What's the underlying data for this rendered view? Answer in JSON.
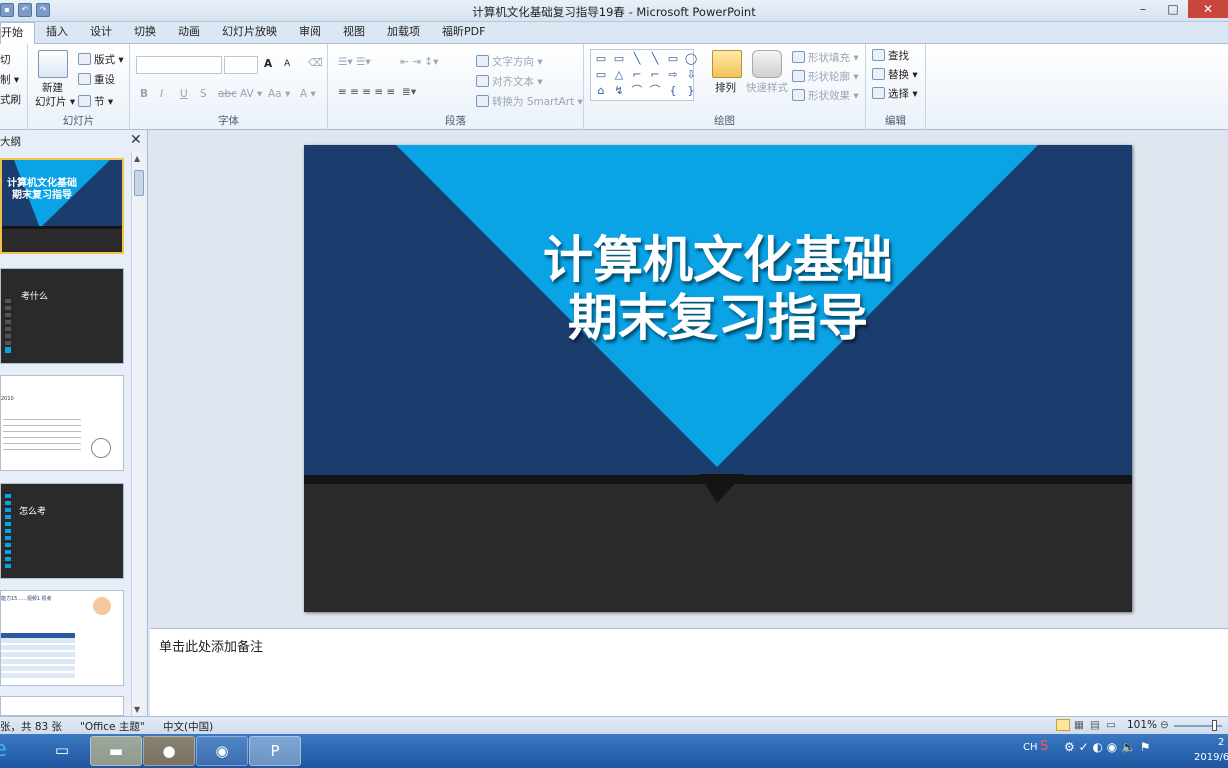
{
  "window": {
    "title": "计算机文化基础复习指导19春  -  Microsoft PowerPoint",
    "buttons": {
      "minimize": "–",
      "maximize": "□",
      "close": "✕"
    }
  },
  "tabs": [
    "开始",
    "插入",
    "设计",
    "切换",
    "动画",
    "幻灯片放映",
    "审阅",
    "视图",
    "加载项",
    "福昕PDF"
  ],
  "ribbon": {
    "clipboard": {
      "cut": "切",
      "copy": "制 ▾",
      "painter": "式刷",
      "label": ""
    },
    "slides": {
      "new_slide_line1": "新建",
      "new_slide_line2": "幻灯片 ▾",
      "layout": "版式 ▾",
      "reset": "重设",
      "section": "节 ▾",
      "label": "幻灯片"
    },
    "font": {
      "label": "字体",
      "bold": "B",
      "italic": "I",
      "underline": "U",
      "strike": "S",
      "abc": "abc",
      "spacing": "AV ▾",
      "case": "Aa ▾",
      "color": "A ▾",
      "grow": "A",
      "shrink": "A"
    },
    "paragraph": {
      "label": "段落",
      "text_direction": "文字方向 ▾",
      "align_text": "对齐文本 ▾",
      "smartart": "转换为 SmartArt ▾"
    },
    "drawing": {
      "label": "绘图",
      "arrange": "排列",
      "quick_styles": "快速样式",
      "shape_fill": "形状填充 ▾",
      "shape_outline": "形状轮廓 ▾",
      "shape_effects": "形状效果 ▾"
    },
    "editing": {
      "label": "编辑",
      "find": "查找",
      "replace": "替换 ▾",
      "select": "选择 ▾"
    },
    "shape_glyphs": [
      "▭",
      "▭",
      "╲",
      "╲",
      "▭",
      "◯",
      "▭",
      "△",
      "⌐",
      "⌐",
      "⇨",
      "⇩",
      "⌂",
      "↯",
      "⌒",
      "⌒",
      "{",
      "}"
    ]
  },
  "left_pane": {
    "tab_label": "大纲",
    "close": "✕",
    "thumbnails": [
      {
        "title": "计算机文化基础\n期末复习指导"
      },
      {
        "title": "考什么"
      },
      {
        "title": "2010"
      },
      {
        "title": "怎么考"
      },
      {
        "title": "能力15......视频1 机考"
      }
    ]
  },
  "slide": {
    "title_line1": "计算机文化基础",
    "title_line2": "期末复习指导",
    "colors": {
      "navy": "#1b3d6e",
      "cyan": "#09a3e6",
      "dark": "#2a2a2a",
      "band": "#141414"
    }
  },
  "notes": {
    "placeholder": "单击此处添加备注"
  },
  "statusbar": {
    "slide_count": "张，共 83 张",
    "theme": "\"Office 主题\"",
    "language": "中文(中国)",
    "zoom": "101%"
  },
  "taskbar": {
    "tray_lang": "CH",
    "time": "2",
    "date": "2019/6"
  }
}
